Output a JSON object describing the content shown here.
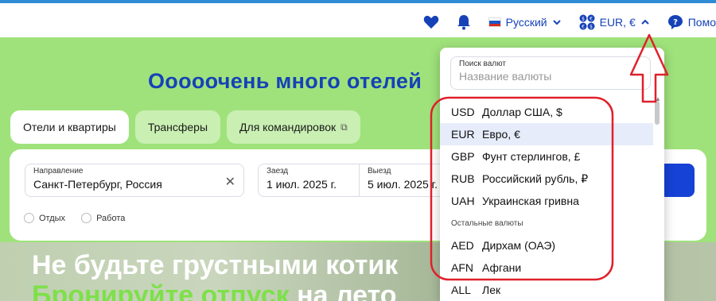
{
  "topbar": {
    "language_label": "Русский",
    "currency_label": "EUR, €",
    "help_label": "Помо"
  },
  "hero": {
    "title": "Ооооочень много отелей"
  },
  "tabs": [
    {
      "label": "Отели и квартиры",
      "active": true
    },
    {
      "label": "Трансферы",
      "active": false
    },
    {
      "label": "Для командировок",
      "active": false
    }
  ],
  "search": {
    "destination_label": "Направление",
    "destination_value": "Санкт-Петербург, Россия",
    "checkin_label": "Заезд",
    "checkin_value": "1 июл. 2025 г.",
    "checkout_label": "Выезд",
    "checkout_value": "5 июл. 2025 г.",
    "trip_purpose": [
      "Отдых",
      "Работа"
    ]
  },
  "banner": {
    "line1": "Не будьте грустными котик",
    "line2_highlight": "Бронируйте отпуск",
    "line2_rest": " на лето"
  },
  "currency_dropdown": {
    "search_label": "Поиск валют",
    "search_placeholder": "Название валюты",
    "popular": [
      {
        "code": "USD",
        "name": "Доллар США, $"
      },
      {
        "code": "EUR",
        "name": "Евро, €",
        "selected": true
      },
      {
        "code": "GBP",
        "name": "Фунт стерлингов, £"
      },
      {
        "code": "RUB",
        "name": "Российский рубль, ₽"
      },
      {
        "code": "UAH",
        "name": "Украинская гривна"
      }
    ],
    "other_section_label": "Остальные валюты",
    "others": [
      {
        "code": "AED",
        "name": "Дирхам (ОАЭ)"
      },
      {
        "code": "AFN",
        "name": "Афгани"
      },
      {
        "code": "ALL",
        "name": "Лек"
      }
    ]
  },
  "colors": {
    "brand_blue": "#1642b8",
    "hero_green": "#9fe27b",
    "annotation_red": "#e0202c",
    "selected_row": "#e6ecfa"
  }
}
